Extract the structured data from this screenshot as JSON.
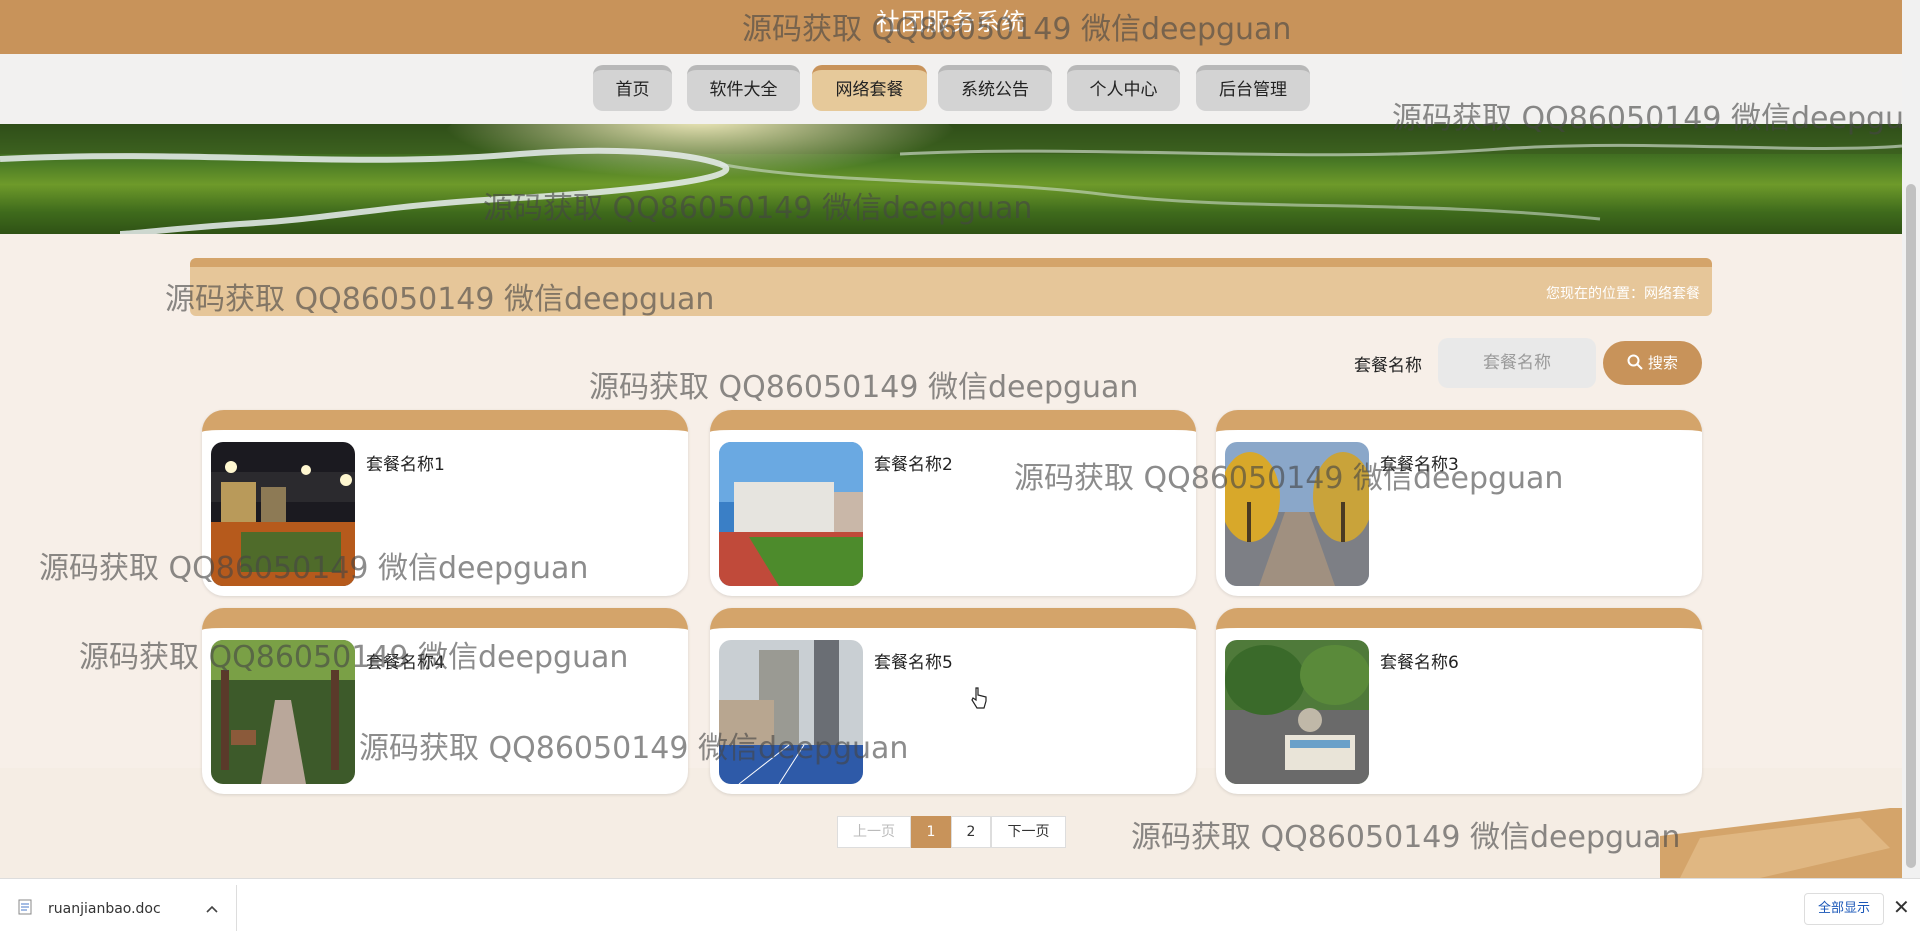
{
  "header": {
    "title": "社团服务系统"
  },
  "nav": {
    "items": [
      {
        "label": "首页",
        "active": false
      },
      {
        "label": "软件大全",
        "active": false
      },
      {
        "label": "网络套餐",
        "active": true
      },
      {
        "label": "系统公告",
        "active": false
      },
      {
        "label": "个人中心",
        "active": false
      },
      {
        "label": "后台管理",
        "active": false
      }
    ]
  },
  "breadcrumb": {
    "text": "您现在的位置：网络套餐"
  },
  "search": {
    "label": "套餐名称",
    "placeholder": "套餐名称",
    "button_label": "搜索"
  },
  "cards": [
    {
      "name": "套餐名称1"
    },
    {
      "name": "套餐名称2"
    },
    {
      "name": "套餐名称3"
    },
    {
      "name": "套餐名称4"
    },
    {
      "name": "套餐名称5"
    },
    {
      "name": "套餐名称6"
    }
  ],
  "pagination": {
    "prev": "上一页",
    "pages": [
      "1",
      "2"
    ],
    "current": "1",
    "next": "下一页"
  },
  "watermark": {
    "text": "源码获取 QQ86050149 微信deepguan"
  },
  "download": {
    "filename": "ruanjianbao.doc",
    "show_all": "全部显示",
    "close": "✕"
  },
  "colors": {
    "accent": "#c8935a",
    "accent_light": "#e6c699",
    "nav_item": "#d3d3d3"
  }
}
